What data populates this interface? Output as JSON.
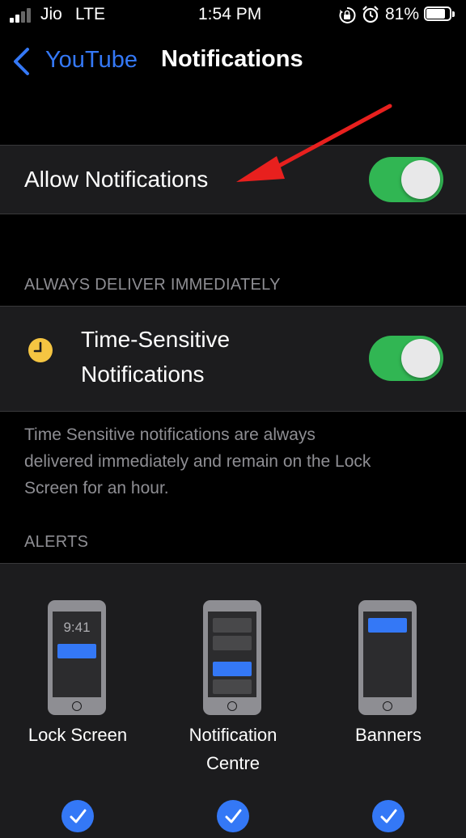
{
  "status_bar": {
    "carrier": "Jio",
    "network": "LTE",
    "time": "1:54 PM",
    "battery_percent": "81%",
    "battery_level": 0.81,
    "icons": [
      "signal-icon",
      "orientation-lock-icon",
      "alarm-icon",
      "battery-icon"
    ]
  },
  "nav": {
    "back_label": "YouTube",
    "title": "Notifications"
  },
  "allow_notifications": {
    "label": "Allow Notifications",
    "enabled": true
  },
  "time_sensitive_section": {
    "header": "ALWAYS DELIVER IMMEDIATELY",
    "label_line1": "Time-Sensitive",
    "label_line2": "Notifications",
    "enabled": true,
    "icon": "clock-icon",
    "footer_line1": "Time Sensitive notifications are always",
    "footer_line2": "delivered immediately and remain on the Lock",
    "footer_line3": "Screen for an hour."
  },
  "alerts_section": {
    "header": "ALERTS",
    "options": [
      {
        "label": "Lock Screen",
        "preview_time": "9:41",
        "checked": true
      },
      {
        "label_line1": "Notification",
        "label_line2": "Centre",
        "checked": true
      },
      {
        "label": "Banners",
        "checked": true
      }
    ]
  },
  "colors": {
    "accent": "#3478f6",
    "toggle_on": "#34c759",
    "cell_bg": "#1c1c1e",
    "secondary_text": "#8e8e93",
    "clock_icon": "#f5c542",
    "arrow": "#e8201e"
  }
}
